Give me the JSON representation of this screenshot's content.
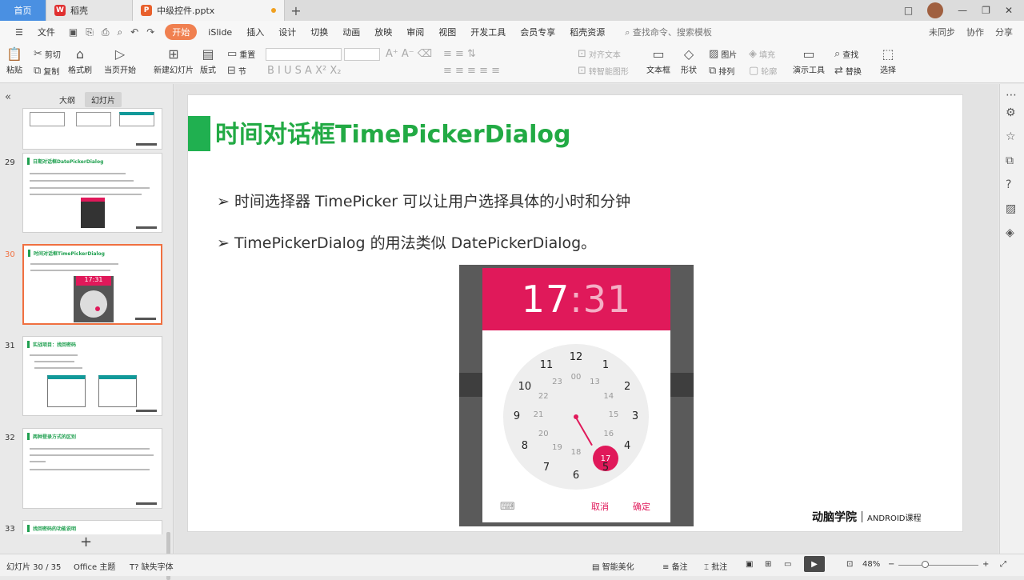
{
  "titlebar": {
    "home_tab": "首页",
    "wps_tab": "稻壳",
    "doc_tab": "中级控件.pptx",
    "new_tab": "+",
    "win_buttons": [
      "□",
      "—",
      "❐",
      "✕"
    ]
  },
  "menubar": {
    "file": "文件",
    "items": [
      "开始",
      "iSlide",
      "插入",
      "设计",
      "切换",
      "动画",
      "放映",
      "审阅",
      "视图",
      "开发工具",
      "会员专享",
      "稻壳资源"
    ],
    "search_placeholder": "查找命令、搜索模板",
    "right": [
      "未同步",
      "协作",
      "分享"
    ]
  },
  "ribbon": {
    "paste": "粘贴",
    "cut": "剪切",
    "copy": "复制",
    "format_painter": "格式刷",
    "from_current": "当页开始",
    "new_slide": "新建幻灯片",
    "layout": "版式",
    "section": "节",
    "reset": "重置",
    "align_text": "对齐文本",
    "smart_art": "转智能图形",
    "textbox": "文本框",
    "shape": "形状",
    "picture": "图片",
    "fill": "填充",
    "arrange": "排列",
    "outline": "轮廓",
    "presenter": "演示工具",
    "find": "查找",
    "replace": "替换",
    "select": "选择"
  },
  "panel": {
    "outline_tab": "大纲",
    "slides_tab": "幻灯片",
    "thumbs": [
      {
        "num": "29",
        "title": "日期对话框DatePickerDialog"
      },
      {
        "num": "30",
        "title": "时间对话框TimePickerDialog",
        "time": "17:31"
      },
      {
        "num": "31",
        "title": "实战项目：找回密码"
      },
      {
        "num": "32",
        "title": "两种登录方式的区别"
      },
      {
        "num": "33",
        "title": "找回密码的功能说明"
      }
    ]
  },
  "slide": {
    "title": "时间对话框TimePickerDialog",
    "bullets": [
      "时间选择器 TimePicker 可以让用户选择具体的小时和分钟",
      "TimePickerDialog 的用法类似 DatePickerDialog。"
    ],
    "dialog": {
      "hour": "17",
      "colon": ":",
      "minute": "31",
      "outer": [
        "12",
        "1",
        "2",
        "3",
        "4",
        "5",
        "6",
        "7",
        "8",
        "9",
        "10",
        "11"
      ],
      "inner": [
        "00",
        "13",
        "14",
        "15",
        "16",
        "17",
        "18",
        "19",
        "20",
        "21",
        "22",
        "23"
      ],
      "cancel": "取消",
      "confirm": "确定",
      "keyboard_icon": "keyboard-icon"
    },
    "brand_logo": "动脑学院",
    "brand_course": "ANDROID课程"
  },
  "status": {
    "slide_counter": "幻灯片 30 / 35",
    "theme": "Office 主题",
    "missing_font": "缺失字体",
    "beautify": "智能美化",
    "notes": "备注",
    "comments": "批注",
    "zoom": "48%"
  }
}
